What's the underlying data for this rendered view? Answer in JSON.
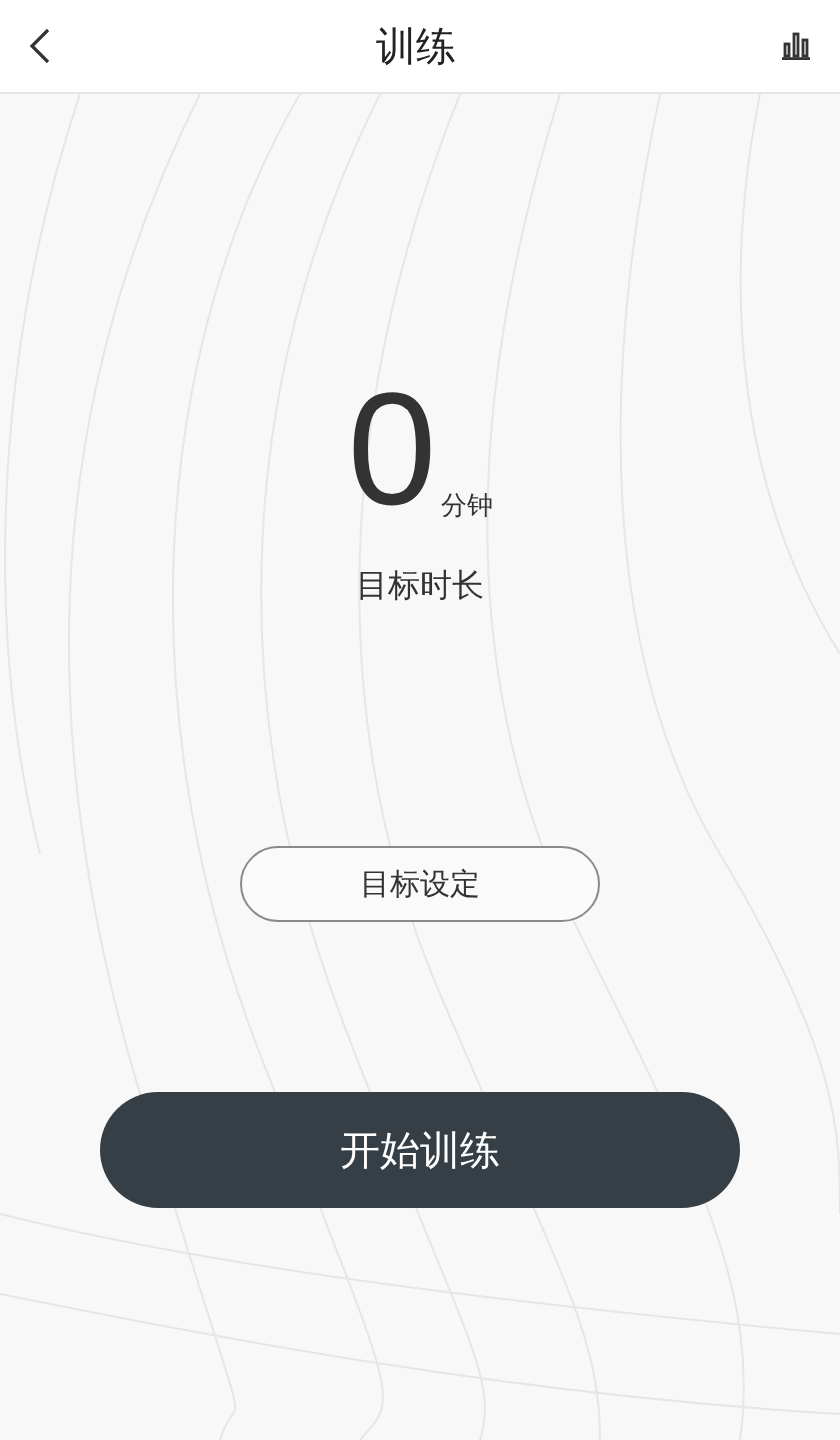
{
  "header": {
    "title": "训练"
  },
  "goal": {
    "value": "0",
    "unit": "分钟",
    "label": "目标时长"
  },
  "buttons": [
    {
      "label": "目标设定",
      "kind": "outline"
    },
    {
      "label": "开始训练",
      "kind": "primary"
    }
  ]
}
